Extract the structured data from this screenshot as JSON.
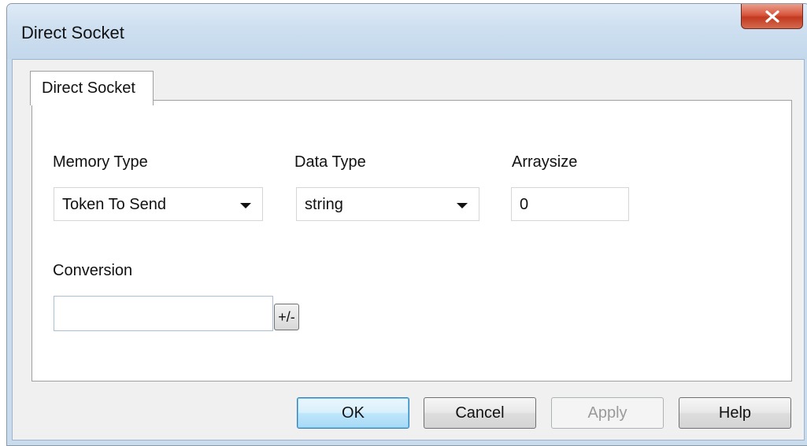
{
  "window": {
    "title": "Direct Socket",
    "close_icon": "close-icon"
  },
  "tab": {
    "label": "Direct Socket"
  },
  "form": {
    "memory_type": {
      "label": "Memory Type",
      "value": "Token To Send"
    },
    "data_type": {
      "label": "Data Type",
      "value": "string"
    },
    "arraysize": {
      "label": "Arraysize",
      "value": "0"
    },
    "conversion": {
      "label": "Conversion",
      "value": "",
      "toggle_label": "+/-"
    }
  },
  "buttons": {
    "ok": "OK",
    "cancel": "Cancel",
    "apply": "Apply",
    "help": "Help"
  },
  "colors": {
    "close_button": "#c23a20",
    "default_button_border": "#3c7fb1",
    "title_bar": "#cddff0"
  }
}
